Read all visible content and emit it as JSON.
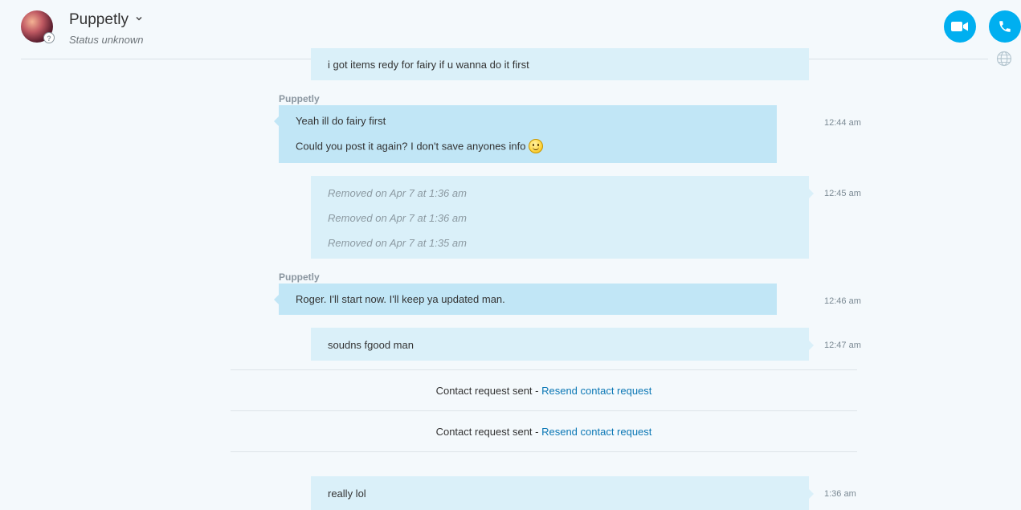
{
  "header": {
    "contact_name": "Puppetly",
    "status": "Status unknown",
    "status_glyph": "?"
  },
  "messages": {
    "m0_text": "i got items redy for fairy if u wanna do it first",
    "g1_sender": "Puppetly",
    "g1_line1": "Yeah ill do fairy first",
    "g1_line2": "Could you post it again? I don't save anyones info",
    "g1_time": "12:44 am",
    "g2_removed1": "Removed on Apr 7 at 1:36 am",
    "g2_removed2": "Removed on Apr 7 at 1:36 am",
    "g2_removed3": "Removed on Apr 7 at 1:35 am",
    "g2_time": "12:45 am",
    "g3_sender": "Puppetly",
    "g3_text": "Roger. I'll start now. I'll keep ya updated man.",
    "g3_time": "12:46 am",
    "g4_text": "soudns fgood man",
    "g4_time": "12:47 am",
    "g5_text": "really lol",
    "g5_time": "1:36 am"
  },
  "system": {
    "contact_sent_1": "Contact request sent - ",
    "resend_1": "Resend contact request",
    "contact_sent_2": "Contact request sent - ",
    "resend_2": "Resend contact request"
  },
  "icons": {
    "video": "video-camera-icon",
    "call": "phone-icon",
    "translate": "globe-icon",
    "emoji": "smile-emoji-icon"
  },
  "colors": {
    "accent": "#00aff0",
    "incoming_bubble": "#c1e6f6",
    "outgoing_bubble": "#daf0f9",
    "link": "#0b77b5"
  }
}
